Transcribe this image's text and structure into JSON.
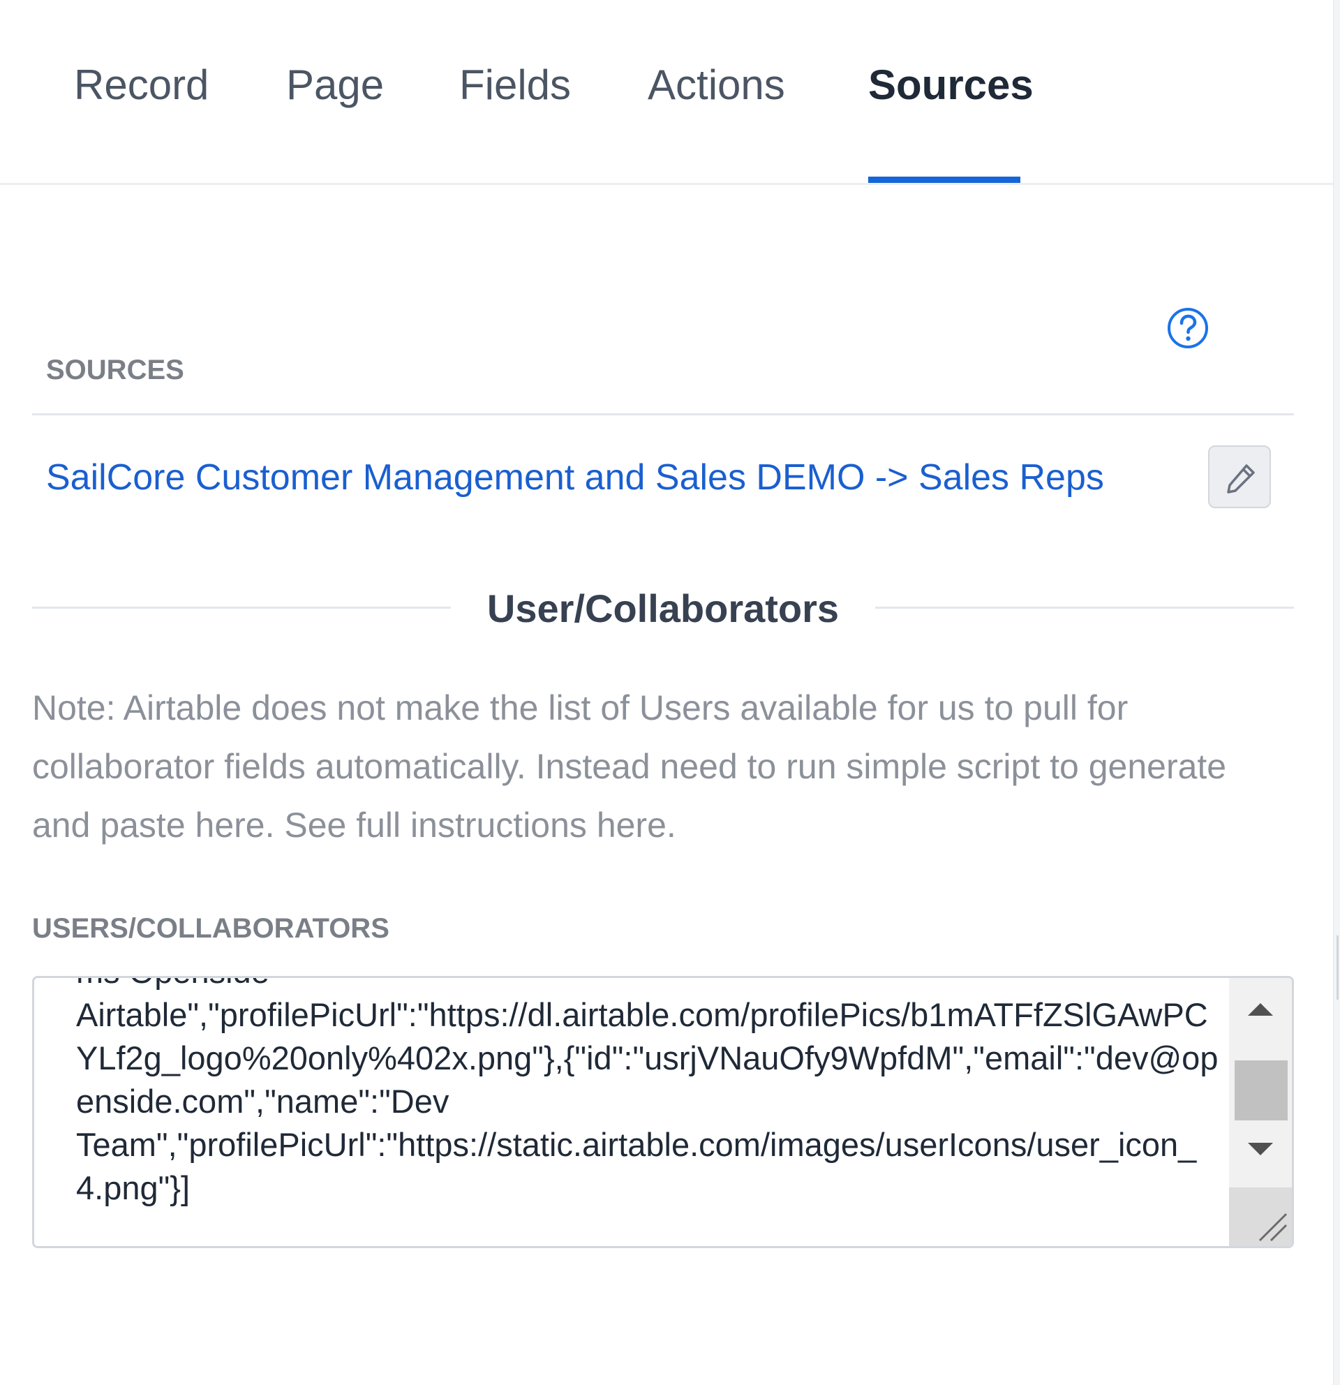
{
  "tabs": [
    {
      "label": "Record"
    },
    {
      "label": "Page"
    },
    {
      "label": "Fields"
    },
    {
      "label": "Actions"
    },
    {
      "label": "Sources"
    }
  ],
  "active_tab": "Sources",
  "sources": {
    "label": "SOURCES",
    "link_text": "SailCore Customer Management and Sales DEMO -> Sales Reps",
    "help_icon": "question-circle-icon",
    "edit_icon": "pencil-icon"
  },
  "collaborators": {
    "heading": "User/Collaborators",
    "note": "Note: Airtable does not make the list of Users available for us to pull for collaborator fields automatically. Instead need to run simple script to generate and paste here. See full instructions here.",
    "field_label": "USERS/COLLABORATORS",
    "textarea_value": "ms Openside\nAirtable\",\"profilePicUrl\":\"https://dl.airtable.com/profilePics/b1mATFfZSlGAwPCYLf2g_logo%20only%402x.png\"},{\"id\":\"usrjVNauOfy9WpfdM\",\"email\":\"dev@openside.com\",\"name\":\"Dev\nTeam\",\"profilePicUrl\":\"https://static.airtable.com/images/userIcons/user_icon_4.png\"}]"
  },
  "colors": {
    "accent": "#1565d8",
    "link": "#1a5fd0",
    "muted_text": "#8b9099"
  }
}
